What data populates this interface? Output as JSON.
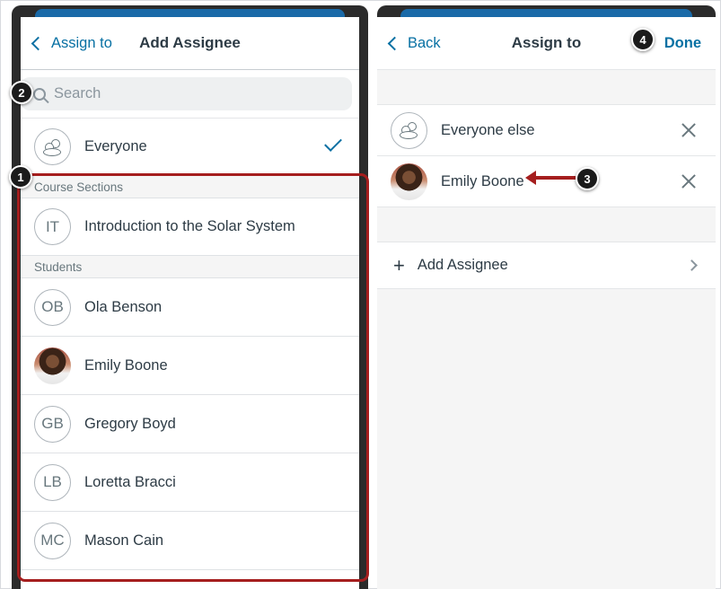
{
  "left_panel": {
    "nav": {
      "back_label": "Assign to",
      "title": "Add Assignee"
    },
    "search": {
      "placeholder": "Search",
      "value": ""
    },
    "everyone": {
      "label": "Everyone",
      "selected": true
    },
    "sections": [
      {
        "header": "Course Sections",
        "items": [
          {
            "initials": "IT",
            "name": "Introduction to the Solar System"
          }
        ]
      },
      {
        "header": "Students",
        "items": [
          {
            "initials": "OB",
            "name": "Ola Benson"
          },
          {
            "initials": "",
            "name": "Emily Boone",
            "photo": true
          },
          {
            "initials": "GB",
            "name": "Gregory Boyd"
          },
          {
            "initials": "LB",
            "name": "Loretta Bracci"
          },
          {
            "initials": "MC",
            "name": "Mason Cain"
          }
        ]
      }
    ]
  },
  "right_panel": {
    "nav": {
      "back_label": "Back",
      "title": "Assign to",
      "done_label": "Done"
    },
    "assignees": [
      {
        "name": "Everyone else",
        "icon": "group-icon"
      },
      {
        "name": "Emily Boone",
        "photo": true
      }
    ],
    "add_label": "Add Assignee"
  },
  "annotations": [
    "1",
    "2",
    "3",
    "4"
  ],
  "colors": {
    "link": "#0770a3",
    "annotation": "#a51e1e",
    "badge": "#1b1b1b"
  }
}
